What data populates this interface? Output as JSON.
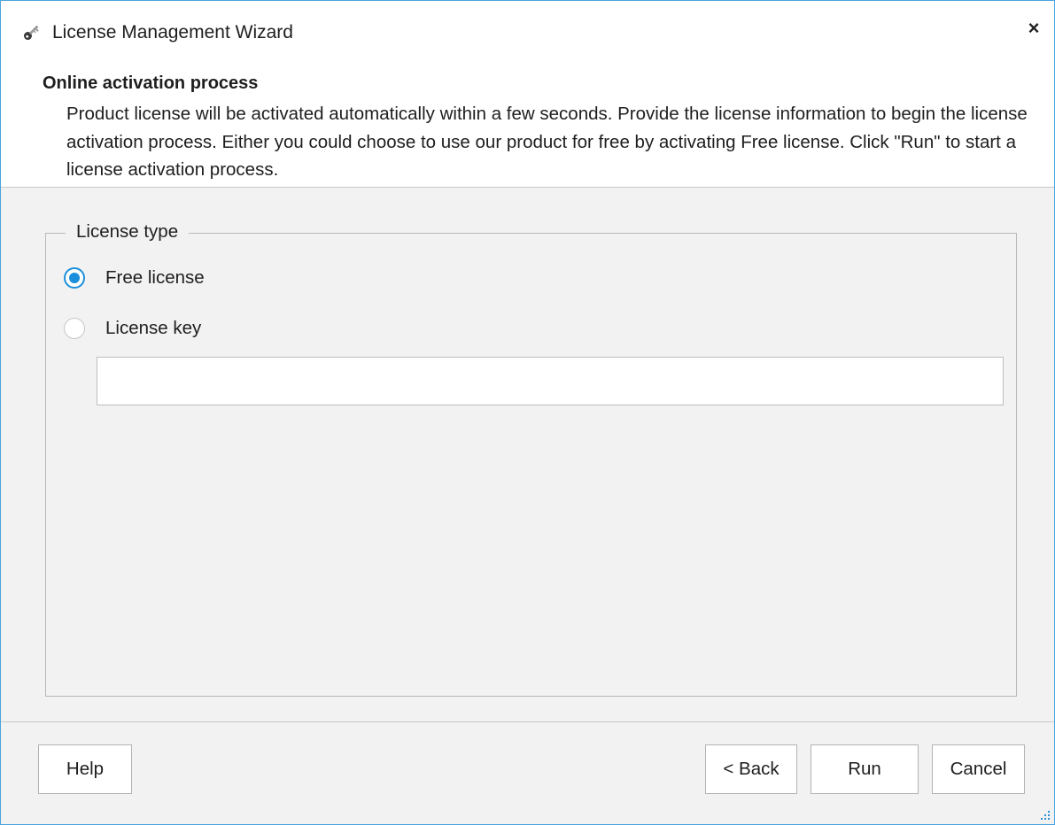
{
  "window": {
    "title": "License Management Wizard",
    "close_glyph": "×",
    "icon": "key-icon"
  },
  "header": {
    "title": "Online activation process",
    "description": "Product license will be activated automatically within a few seconds. Provide the license information to begin the license activation process. Either you could choose to use our product for free by activating Free license. Click \"Run\" to start a license activation process."
  },
  "license_type": {
    "legend": "License type",
    "options": [
      {
        "label": "Free license",
        "checked": true
      },
      {
        "label": "License key",
        "checked": false
      }
    ],
    "key_input": {
      "value": "",
      "placeholder": ""
    }
  },
  "buttons": {
    "help": "Help",
    "back": "< Back",
    "run": "Run",
    "cancel": "Cancel"
  },
  "colors": {
    "accent": "#1b8fdb",
    "window_border": "#4aa3df",
    "body_background": "#f2f2f2"
  }
}
